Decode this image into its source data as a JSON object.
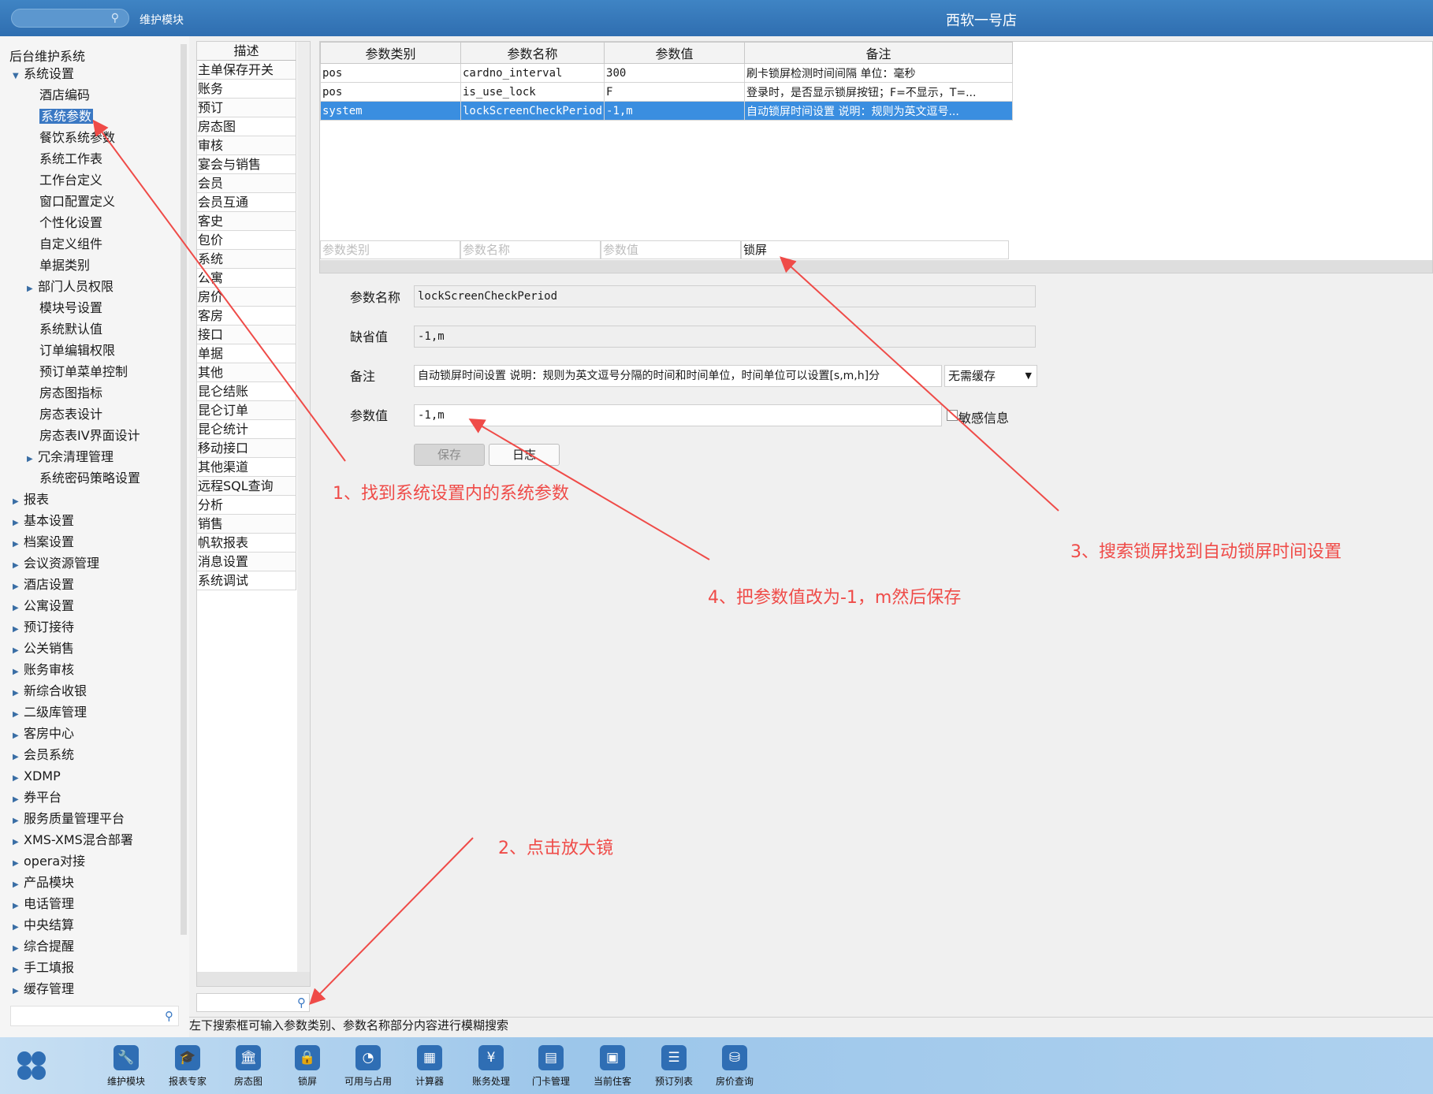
{
  "topbar": {
    "module": "维护模块",
    "store": "西软一号店"
  },
  "tree": {
    "root": "后台维护系统",
    "items": [
      {
        "label": "系统设置",
        "level": 0,
        "expanded": true
      },
      {
        "label": "酒店编码",
        "level": 1
      },
      {
        "label": "系统参数",
        "level": 1,
        "selected": true
      },
      {
        "label": "餐饮系统参数",
        "level": 1
      },
      {
        "label": "系统工作表",
        "level": 1
      },
      {
        "label": "工作台定义",
        "level": 1
      },
      {
        "label": "窗口配置定义",
        "level": 1
      },
      {
        "label": "个性化设置",
        "level": 1
      },
      {
        "label": "自定义组件",
        "level": 1
      },
      {
        "label": "单据类别",
        "level": 1
      },
      {
        "label": "部门人员权限",
        "level": 1,
        "collapsible": true
      },
      {
        "label": "模块号设置",
        "level": 1
      },
      {
        "label": "系统默认值",
        "level": 1
      },
      {
        "label": "订单编辑权限",
        "level": 1
      },
      {
        "label": "预订单菜单控制",
        "level": 1
      },
      {
        "label": "房态图指标",
        "level": 1
      },
      {
        "label": "房态表设计",
        "level": 1
      },
      {
        "label": "房态表IV界面设计",
        "level": 1
      },
      {
        "label": "冗余清理管理",
        "level": 1,
        "collapsible": true
      },
      {
        "label": "系统密码策略设置",
        "level": 1
      },
      {
        "label": "报表",
        "level": 0
      },
      {
        "label": "基本设置",
        "level": 0
      },
      {
        "label": "档案设置",
        "level": 0
      },
      {
        "label": "会议资源管理",
        "level": 0
      },
      {
        "label": "酒店设置",
        "level": 0
      },
      {
        "label": "公寓设置",
        "level": 0
      },
      {
        "label": "预订接待",
        "level": 0
      },
      {
        "label": "公关销售",
        "level": 0
      },
      {
        "label": "账务审核",
        "level": 0
      },
      {
        "label": "新综合收银",
        "level": 0
      },
      {
        "label": "二级库管理",
        "level": 0
      },
      {
        "label": "客房中心",
        "level": 0
      },
      {
        "label": "会员系统",
        "level": 0
      },
      {
        "label": "XDMP",
        "level": 0
      },
      {
        "label": "券平台",
        "level": 0
      },
      {
        "label": "服务质量管理平台",
        "level": 0
      },
      {
        "label": "XMS-XMS混合部署",
        "level": 0
      },
      {
        "label": "opera对接",
        "level": 0
      },
      {
        "label": "产品模块",
        "level": 0
      },
      {
        "label": "电话管理",
        "level": 0
      },
      {
        "label": "中央结算",
        "level": 0
      },
      {
        "label": "综合提醒",
        "level": 0
      },
      {
        "label": "手工填报",
        "level": 0
      },
      {
        "label": "缓存管理",
        "level": 0
      }
    ]
  },
  "midlist": {
    "header": "描述",
    "items": [
      "主单保存开关",
      "账务",
      "预订",
      "房态图",
      "审核",
      "宴会与销售",
      "会员",
      "会员互通",
      "客史",
      "包价",
      "系统",
      "公寓",
      "房价",
      "客房",
      "接口",
      "单据",
      "其他",
      "昆仑结账",
      "昆仑订单",
      "昆仑统计",
      "移动接口",
      "其他渠道",
      "远程SQL查询",
      "分析",
      "销售",
      "帆软报表",
      "消息设置",
      "系统调试"
    ]
  },
  "grid": {
    "columns": [
      "参数类别",
      "参数名称",
      "参数值",
      "备注"
    ],
    "rows": [
      [
        "pos",
        "cardno_interval",
        "300",
        "刷卡锁屏检测时间间隔 单位：毫秒"
      ],
      [
        "pos",
        "is_use_lock",
        "F",
        "登录时，是否显示锁屏按钮；F=不显示，T=..."
      ],
      [
        "system",
        "lockScreenCheckPeriod",
        "-1,m",
        "自动锁屏时间设置 说明：规则为英文逗号..."
      ]
    ],
    "selected_row": 2,
    "filters": {
      "category_placeholder": "参数类别",
      "name_placeholder": "参数名称",
      "value_placeholder": "参数值",
      "remark_value": "锁屏"
    }
  },
  "form": {
    "name_label": "参数名称",
    "name_value": "lockScreenCheckPeriod",
    "default_label": "缺省值",
    "default_value": "-1,m",
    "remark_label": "备注",
    "remark_value": "自动锁屏时间设置 说明：规则为英文逗号分隔的时间和时间单位，时间单位可以设置[s,m,h]分",
    "cache_option": "无需缓存",
    "value_label": "参数值",
    "value_value": "-1,m",
    "sensitive_label": "敏感信息",
    "save_label": "保存",
    "log_label": "日志"
  },
  "status_text": "左下搜索框可输入参数类别、参数名称部分内容进行模糊搜索",
  "dock": [
    {
      "label": "维护模块",
      "icon": "wrench-icon",
      "glyph": "🔧"
    },
    {
      "label": "报表专家",
      "icon": "graduation-cap-icon",
      "glyph": "🎓"
    },
    {
      "label": "房态图",
      "icon": "bank-icon",
      "glyph": "🏛"
    },
    {
      "label": "锁屏",
      "icon": "lock-icon",
      "glyph": "🔒"
    },
    {
      "label": "可用与占用",
      "icon": "pie-chart-icon",
      "glyph": "◔"
    },
    {
      "label": "计算器",
      "icon": "calculator-icon",
      "glyph": "▦"
    },
    {
      "label": "账务处理",
      "icon": "money-icon",
      "glyph": "¥"
    },
    {
      "label": "门卡管理",
      "icon": "card-icon",
      "glyph": "▤"
    },
    {
      "label": "当前住客",
      "icon": "guest-card-icon",
      "glyph": "▣"
    },
    {
      "label": "预订列表",
      "icon": "reservation-list-icon",
      "glyph": "☰"
    },
    {
      "label": "房价查询",
      "icon": "database-icon",
      "glyph": "⛁"
    }
  ],
  "annotations": {
    "a1": "1、找到系统设置内的系统参数",
    "a2": "2、点击放大镜",
    "a3": "3、搜索锁屏找到自动锁屏时间设置",
    "a4": "4、把参数值改为-1，m然后保存",
    "color": "#ef4b48"
  }
}
